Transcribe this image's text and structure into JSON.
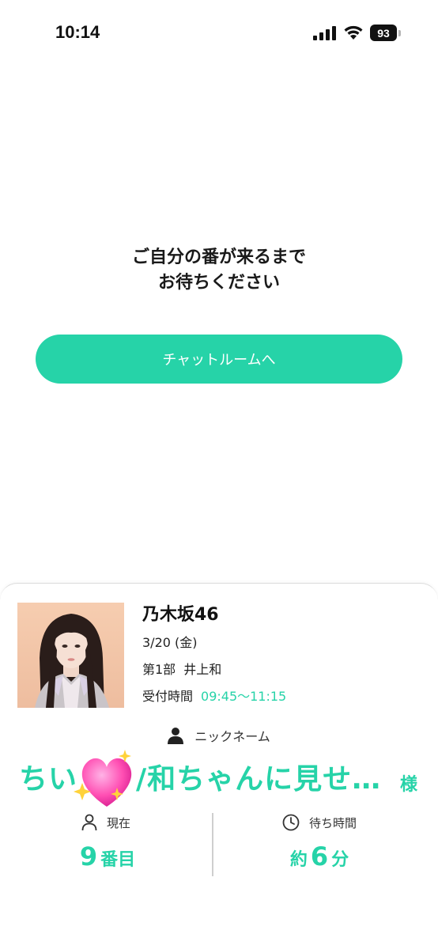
{
  "status_bar": {
    "time": "10:14",
    "battery": "93",
    "icons": [
      "signal-icon",
      "wifi-icon",
      "battery-icon"
    ]
  },
  "main": {
    "message_line1": "ご自分の番が来るまで",
    "message_line2": "お待ちください",
    "chat_button_label": "チャットルームへ"
  },
  "card": {
    "group_name": "乃木坂46",
    "date": "3/20 (金)",
    "session": "第1部",
    "member": "井上和",
    "reception_label": "受付時間",
    "reception_time": "09:45〜11:15",
    "nickname_label": "ニックネーム",
    "nickname": "ちい　　/和ちゃんに見せ…",
    "nickname_suffix": "様",
    "current_label": "現在",
    "current_value": "9",
    "current_unit": "番目",
    "wait_label": "待ち時間",
    "wait_prefix": "約",
    "wait_value": "6",
    "wait_unit": "分"
  },
  "colors": {
    "accent": "#26d3a8",
    "text": "#1a1a1a",
    "divider": "#cfcfcf",
    "heart": "#ff4fb3"
  }
}
